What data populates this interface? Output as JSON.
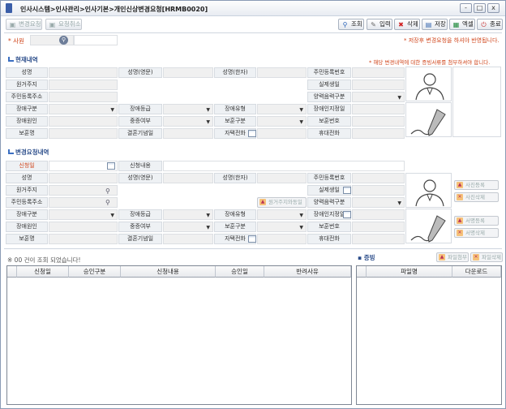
{
  "title": "인사시스템>인사관리>인사기본>개인신상변경요청[HRMB0020]",
  "window_buttons": {
    "minimize": "-",
    "restore": "□",
    "close": "x"
  },
  "toolbar_left": {
    "change_request": "변경요청",
    "request_cancel": "요청취소"
  },
  "toolbar_right": {
    "search": "조회",
    "input": "입력",
    "delete": "삭제",
    "save": "저장",
    "excel": "엑셀",
    "exit": "종료"
  },
  "employee": {
    "label": "사원"
  },
  "notes": {
    "save_note": "* 저장후 변경요청을 하셔야 반영됩니다.",
    "attach_note": "* 해당 변경내역에 대한 증빙서류를 첨부하셔야 합니다."
  },
  "current": {
    "section_title": "현재내역",
    "labels": {
      "name": "성명",
      "name_en": "성명(영문)",
      "name_cn": "성명(한자)",
      "rrn": "주민등록번호",
      "origin_addr": "원거주지",
      "birthday": "실제생일",
      "rrn_addr": "주민등록주소",
      "calendar": "양력음력구분",
      "disability_type": "장애구분",
      "disability_grade": "장애등급",
      "disability_kind": "장애유형",
      "disability_date": "장애인지정일",
      "disability_cause": "장애원인",
      "severity": "중증여부",
      "veteran_type": "보훈구분",
      "veteran_no": "보훈번호",
      "veteran_org": "보훈명",
      "wedding_date": "결혼기념일",
      "home_phone": "자택전화",
      "mobile": "휴대전화"
    }
  },
  "change": {
    "section_title": "변경요청내역",
    "labels": {
      "request_date": "신청일",
      "request_content": "신청내용",
      "name": "성명",
      "name_en": "성명(영문)",
      "name_cn": "성명(한자)",
      "rrn": "주민등록번호",
      "origin_addr": "원거주지",
      "birthday": "실제생일",
      "rrn_addr": "주민등록주소",
      "calendar": "양력음력구분",
      "disability_type": "장애구분",
      "disability_grade": "장애등급",
      "disability_kind": "장애유형",
      "disability_date": "장애인지정일",
      "disability_cause": "장애원인",
      "severity": "중증여부",
      "veteran_type": "보훈구분",
      "veteran_no": "보훈번호",
      "veteran_org": "보훈명",
      "wedding_date": "결혼기념일",
      "home_phone": "자택전화",
      "mobile": "휴대전화"
    },
    "copy_addr_button": "원거주지와동일",
    "photo_buttons": {
      "register": "사진등록",
      "delete": "사진삭제"
    },
    "sign_buttons": {
      "register": "서명등록",
      "delete": "서명삭제"
    }
  },
  "result": {
    "status": "00 건이 조회 되었습니다!",
    "columns": [
      "신청일",
      "승인구분",
      "신청내용",
      "승인일",
      "반려사유"
    ]
  },
  "evidence": {
    "title": "증빙",
    "attach_button": "파일첨부",
    "delete_button": "파일삭제",
    "columns": [
      "파일명",
      "다운로드"
    ]
  }
}
